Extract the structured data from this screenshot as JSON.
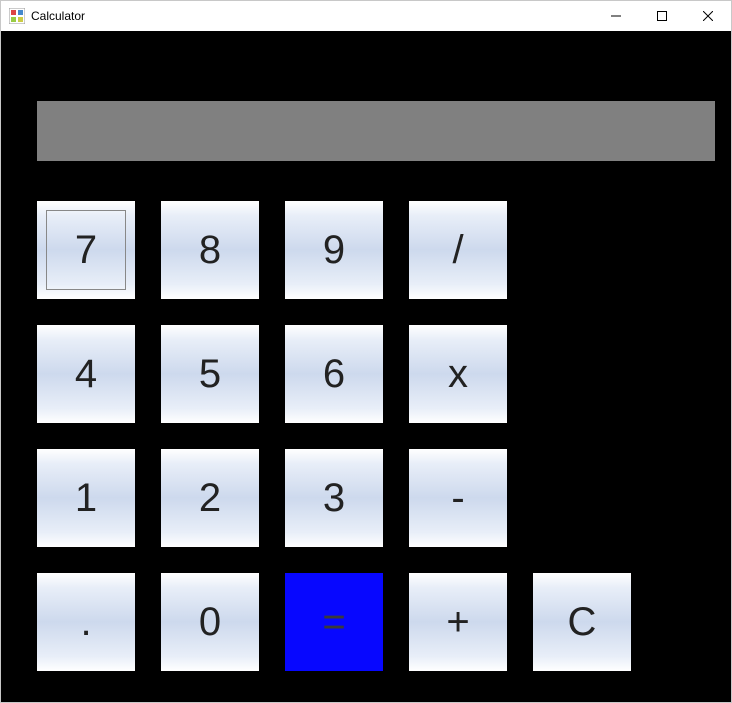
{
  "window": {
    "title": "Calculator"
  },
  "display": {
    "value": ""
  },
  "keys": {
    "r1": {
      "k1": "7",
      "k2": "8",
      "k3": "9",
      "k4": "/"
    },
    "r2": {
      "k1": "4",
      "k2": "5",
      "k3": "6",
      "k4": "x"
    },
    "r3": {
      "k1": "1",
      "k2": "2",
      "k3": "3",
      "k4": "-"
    },
    "r4": {
      "k1": ".",
      "k2": "0",
      "k3": "=",
      "k4": "+",
      "k5": "C"
    }
  }
}
